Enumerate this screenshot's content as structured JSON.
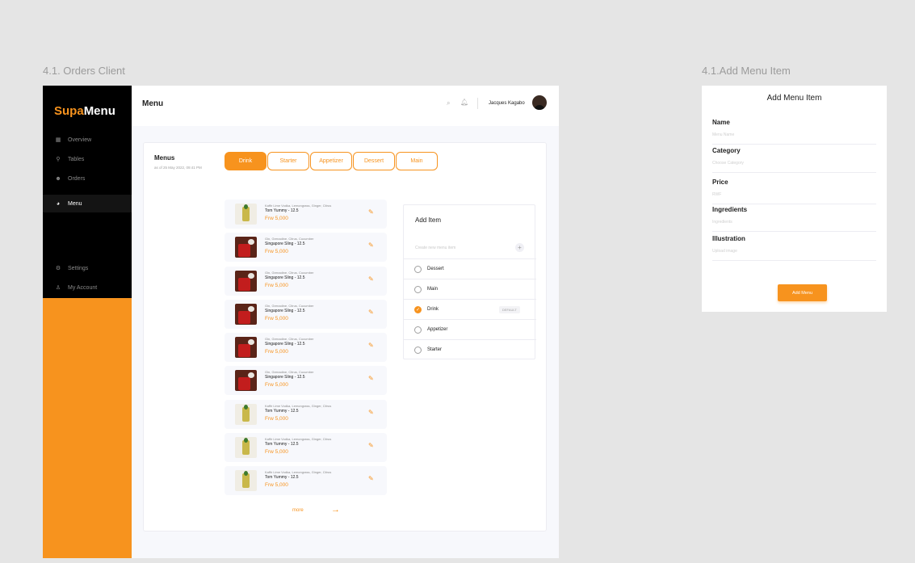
{
  "frame_labels": {
    "orders": "4.1. Orders Client",
    "add_menu": "4.1.Add Menu Item"
  },
  "logo": {
    "part1": "Supa",
    "part2": "Menu"
  },
  "colors": {
    "accent": "#f7931e",
    "sidebar": "#000000"
  },
  "sidebar": {
    "items": [
      {
        "label": "Overview",
        "icon": "grid-icon"
      },
      {
        "label": "Tables",
        "icon": "pin-icon"
      },
      {
        "label": "Orders",
        "icon": "users-icon"
      },
      {
        "label": "Menu",
        "icon": "pie-icon"
      },
      {
        "label": "Settings",
        "icon": "gear-icon"
      },
      {
        "label": "My Account",
        "icon": "person-icon"
      }
    ]
  },
  "header": {
    "title": "Menu",
    "user_name": "Jacques Kagabo"
  },
  "menus": {
    "title": "Menus",
    "date": "as of 25 May 2022, 09:41 PM",
    "tabs": [
      "Drink",
      "Starter",
      "Appetizer",
      "Dessert",
      "Main"
    ],
    "active_tab": "Drink",
    "items": [
      {
        "ingredients": "Kaffir Lime Vodka, Lemongrass, Ginger, Citrus",
        "name": "Tom Yummy - 12.5",
        "price": "Frw 5,000"
      },
      {
        "ingredients": "Gin, Grenadine, Citrus, Cucumber",
        "name": "Singapore Sling - 12.5",
        "price": "Frw 5,000"
      },
      {
        "ingredients": "Gin, Grenadine, Citrus, Cucumber",
        "name": "Singapore Sling - 12.5",
        "price": "Frw 5,000"
      },
      {
        "ingredients": "Gin, Grenadine, Citrus, Cucumber",
        "name": "Singapore Sling - 12.5",
        "price": "Frw 5,000"
      },
      {
        "ingredients": "Gin, Grenadine, Citrus, Cucumber",
        "name": "Singapore Sling - 12.5",
        "price": "Frw 5,000"
      },
      {
        "ingredients": "Gin, Grenadine, Citrus, Cucumber",
        "name": "Singapore Sling - 12.5",
        "price": "Frw 5,000"
      },
      {
        "ingredients": "Kaffir Lime Vodka, Lemongrass, Ginger, Citrus",
        "name": "Tom Yummy - 12.5",
        "price": "Frw 5,000"
      },
      {
        "ingredients": "Kaffir Lime Vodka, Lemongrass, Ginger, Citrus",
        "name": "Tom Yummy - 12.5",
        "price": "Frw 5,000"
      },
      {
        "ingredients": "Kaffir Lime Vodka, Lemongrass, Ginger, Citrus",
        "name": "Tom Yummy - 12.5",
        "price": "Frw 5,000"
      }
    ],
    "more": "more"
  },
  "add_item": {
    "title": "Add Item",
    "placeholder": "Create new menu item",
    "options": [
      {
        "label": "Dessert",
        "checked": false
      },
      {
        "label": "Main",
        "checked": false
      },
      {
        "label": "Drink",
        "checked": true
      },
      {
        "label": "Appetizer",
        "checked": false
      },
      {
        "label": "Starter",
        "checked": false
      }
    ],
    "default_badge": "DEFAULT"
  },
  "add_menu_form": {
    "title": "Add Menu Item",
    "fields": [
      {
        "label": "Name",
        "placeholder": "Menu Name"
      },
      {
        "label": "Category",
        "placeholder": "Choose Category"
      },
      {
        "label": "Price",
        "placeholder": "RWF"
      },
      {
        "label": "Ingredients",
        "placeholder": "Ingredients"
      },
      {
        "label": "Illustration",
        "placeholder": "Upload image"
      }
    ],
    "submit": "Add Menu"
  }
}
